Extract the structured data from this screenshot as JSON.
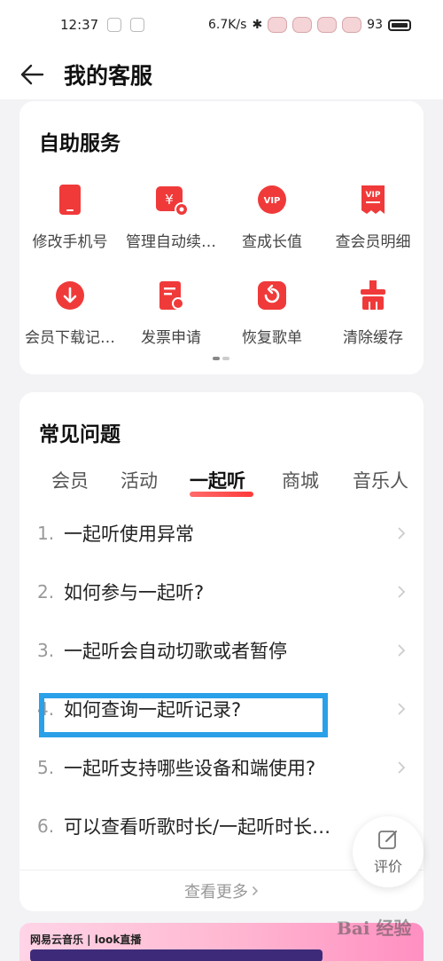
{
  "status_bar": {
    "time": "12:37",
    "network_speed": "6.7K/s",
    "battery": "93"
  },
  "header": {
    "title": "我的客服"
  },
  "self_service": {
    "title": "自助服务",
    "items": [
      {
        "label": "修改手机号",
        "icon": "phone-icon"
      },
      {
        "label": "管理自动续…",
        "icon": "auto-renew-icon"
      },
      {
        "label": "查成长值",
        "icon": "vip-growth-icon"
      },
      {
        "label": "查会员明细",
        "icon": "vip-receipt-icon"
      },
      {
        "label": "会员下载记…",
        "icon": "download-icon"
      },
      {
        "label": "发票申请",
        "icon": "invoice-icon"
      },
      {
        "label": "恢复歌单",
        "icon": "restore-playlist-icon"
      },
      {
        "label": "清除缓存",
        "icon": "clear-cache-icon"
      }
    ]
  },
  "faq": {
    "title": "常见问题",
    "tabs": [
      "会员",
      "活动",
      "一起听",
      "商城",
      "音乐人"
    ],
    "active_tab": "一起听",
    "items": [
      {
        "num": "1.",
        "text": "一起听使用异常"
      },
      {
        "num": "2.",
        "text": "如何参与一起听?"
      },
      {
        "num": "3.",
        "text": "一起听会自动切歌或者暂停"
      },
      {
        "num": "4.",
        "text": "如何查询一起听记录?"
      },
      {
        "num": "5.",
        "text": "一起听支持哪些设备和端使用?"
      },
      {
        "num": "6.",
        "text": "可以查看听歌时长/一起听时长…"
      }
    ],
    "see_more": "查看更多"
  },
  "review_button": {
    "label": "评价"
  },
  "banner": {
    "text": "网易云音乐 | look直播"
  },
  "watermark": {
    "text": "Bai 经验"
  },
  "colors": {
    "accent_red": "#f03a3a",
    "highlight_blue": "#2aa0e8"
  }
}
